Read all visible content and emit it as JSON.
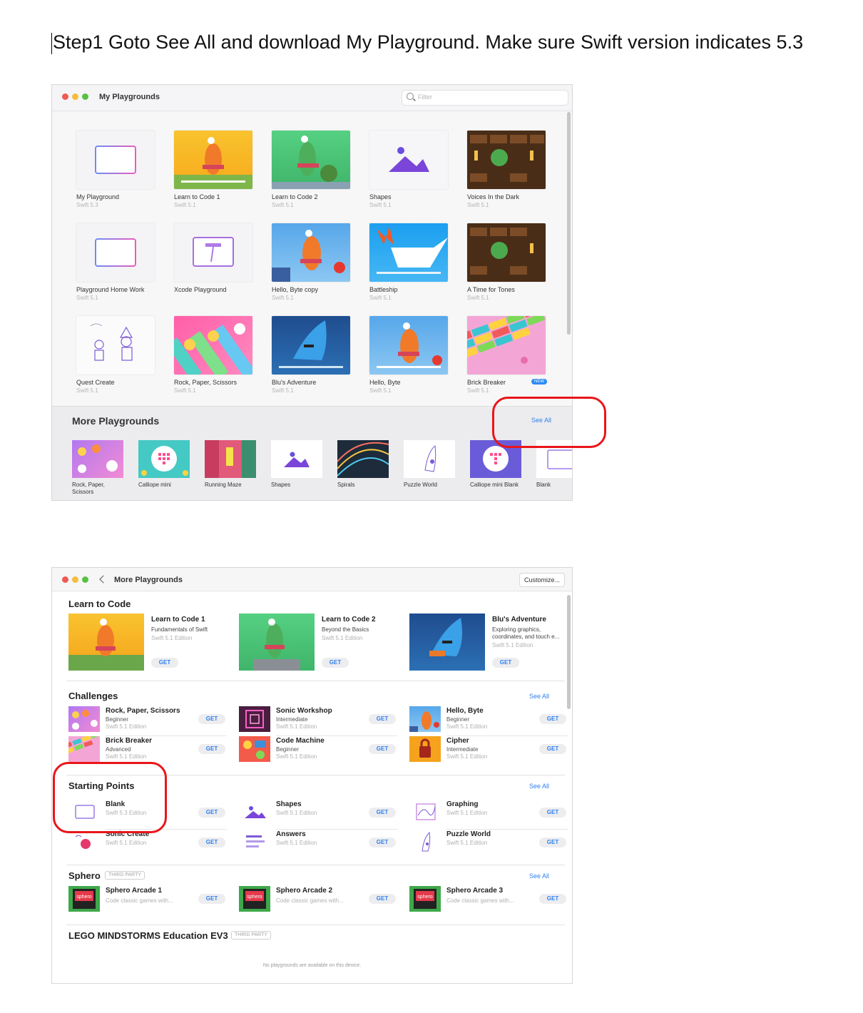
{
  "instruction": "Step1 Goto See All and download My Playground.  Make sure Swift version indicates 5.3",
  "window1": {
    "title": "My Playgrounds",
    "filter_placeholder": "Filter",
    "tiles": [
      {
        "name": "My Playground",
        "sub": "Swift 5.3",
        "icon": "blank-rect-icon"
      },
      {
        "name": "Learn to Code 1",
        "sub": "Swift 5.1",
        "icon": "byte-character-image"
      },
      {
        "name": "Learn to Code 2",
        "sub": "Swift 5.1",
        "icon": "green-character-image"
      },
      {
        "name": "Shapes",
        "sub": "Swift 5.1",
        "icon": "shapes-icon"
      },
      {
        "name": "Voices In the Dark",
        "sub": "Swift 5.1",
        "icon": "dungeon-image"
      },
      {
        "name": "Playground Home Work",
        "sub": "Swift 5.1",
        "icon": "blank-rect-icon"
      },
      {
        "name": "Xcode Playground",
        "sub": "",
        "icon": "hammer-icon"
      },
      {
        "name": "Hello, Byte copy",
        "sub": "Swift 5.1",
        "icon": "byte-character-image"
      },
      {
        "name": "Battleship",
        "sub": "Swift 5.1",
        "icon": "paper-boat-image"
      },
      {
        "name": "A Time for Tones",
        "sub": "Swift 5.1",
        "icon": "dungeon-image"
      },
      {
        "name": "Quest Create",
        "sub": "Swift 5.1",
        "icon": "sketch-characters-image"
      },
      {
        "name": "Rock, Paper, Scissors",
        "sub": "Swift 5.1",
        "icon": "rps-image"
      },
      {
        "name": "Blu's Adventure",
        "sub": "Swift 5.1",
        "icon": "blu-image"
      },
      {
        "name": "Hello, Byte",
        "sub": "Swift 5.1",
        "icon": "byte-character-image"
      },
      {
        "name": "Brick Breaker",
        "sub": "Swift 5.1",
        "icon": "bricks-image",
        "badge": "NEW"
      }
    ],
    "more": {
      "title": "More Playgrounds",
      "see_all": "See All",
      "items": [
        {
          "name": "Rock, Paper, Scissors"
        },
        {
          "name": "Calliope mini"
        },
        {
          "name": "Running Maze"
        },
        {
          "name": "Shapes"
        },
        {
          "name": "Spirals"
        },
        {
          "name": "Puzzle World"
        },
        {
          "name": "Calliope mini Blank"
        },
        {
          "name": "Blank"
        }
      ]
    }
  },
  "window2": {
    "title": "More Playgrounds",
    "customize": "Customize...",
    "get": "GET",
    "see_all": "See All",
    "learn": {
      "title": "Learn to Code",
      "items": [
        {
          "name": "Learn to Code 1",
          "sub": "Fundamentals of Swift",
          "edition": "Swift 5.1 Edition"
        },
        {
          "name": "Learn to Code 2",
          "sub": "Beyond the Basics",
          "edition": "Swift 5.1 Edition"
        },
        {
          "name": "Blu's Adventure",
          "sub": "Exploring graphics, coordinates, and touch e...",
          "edition": "Swift 5.1 Edition"
        }
      ]
    },
    "challenges": {
      "title": "Challenges",
      "items": [
        {
          "name": "Rock, Paper, Scissors",
          "level": "Beginner",
          "edition": "Swift 5.1 Edition"
        },
        {
          "name": "Sonic Workshop",
          "level": "Intermediate",
          "edition": "Swift 5.1 Edition"
        },
        {
          "name": "Hello, Byte",
          "level": "Beginner",
          "edition": "Swift 5.1 Edition"
        },
        {
          "name": "Brick Breaker",
          "level": "Advanced",
          "edition": "Swift 5.1 Edition"
        },
        {
          "name": "Code Machine",
          "level": "Beginner",
          "edition": "Swift 5.1 Edition"
        },
        {
          "name": "Cipher",
          "level": "Intermediate",
          "edition": "Swift 5.1 Edition"
        }
      ]
    },
    "starting": {
      "title": "Starting Points",
      "items": [
        {
          "name": "Blank",
          "edition": "Swift 5.3 Edition"
        },
        {
          "name": "Shapes",
          "edition": "Swift 5.1 Edition"
        },
        {
          "name": "Graphing",
          "edition": "Swift 5.1 Edition"
        },
        {
          "name": "Sonic Create",
          "edition": "Swift 5.1 Edition"
        },
        {
          "name": "Answers",
          "edition": "Swift 5.1 Edition"
        },
        {
          "name": "Puzzle World",
          "edition": "Swift 5.1 Edition"
        }
      ]
    },
    "sphero": {
      "title": "Sphero",
      "badge": "THIRD PARTY",
      "items": [
        {
          "name": "Sphero Arcade 1",
          "desc": "Code classic games with..."
        },
        {
          "name": "Sphero Arcade 2",
          "desc": "Code classic games with..."
        },
        {
          "name": "Sphero Arcade 3",
          "desc": "Code classic games with..."
        }
      ],
      "icon_label": "sphero"
    },
    "lego": {
      "title": "LEGO MINDSTORMS Education EV3",
      "badge": "THIRD PARTY",
      "empty": "No playgrounds are available on this device."
    }
  },
  "colors": {
    "accent": "#2f80ed",
    "highlight": "#e8161a"
  }
}
